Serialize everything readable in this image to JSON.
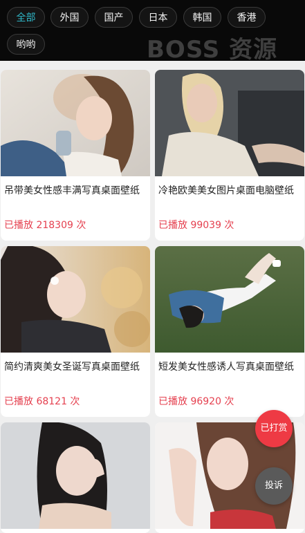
{
  "filters": [
    {
      "label": "全部",
      "active": true
    },
    {
      "label": "外国",
      "active": false
    },
    {
      "label": "国产",
      "active": false
    },
    {
      "label": "日本",
      "active": false
    },
    {
      "label": "韩国",
      "active": false
    },
    {
      "label": "香港",
      "active": false
    },
    {
      "label": "哟哟",
      "active": false
    }
  ],
  "logo_text": "BOSS 资源",
  "cards": [
    {
      "title": "吊带美女性感丰满写真桌面壁纸",
      "plays": "已播放 218309 次"
    },
    {
      "title": "冷艳欧美美女图片桌面电脑壁纸",
      "plays": "已播放 99039 次"
    },
    {
      "title": "简约清爽美女圣诞写真桌面壁纸",
      "plays": "已播放 68121 次"
    },
    {
      "title": "短发美女性感诱人写真桌面壁纸",
      "plays": "已播放 96920 次"
    }
  ],
  "floating": {
    "tip_label": "已打赏",
    "report_label": "投诉"
  },
  "colors": {
    "accent": "#2fb7c8",
    "play_count": "#e5404f",
    "tip_button": "#ee3a44",
    "report_button": "#5a5a5a"
  }
}
